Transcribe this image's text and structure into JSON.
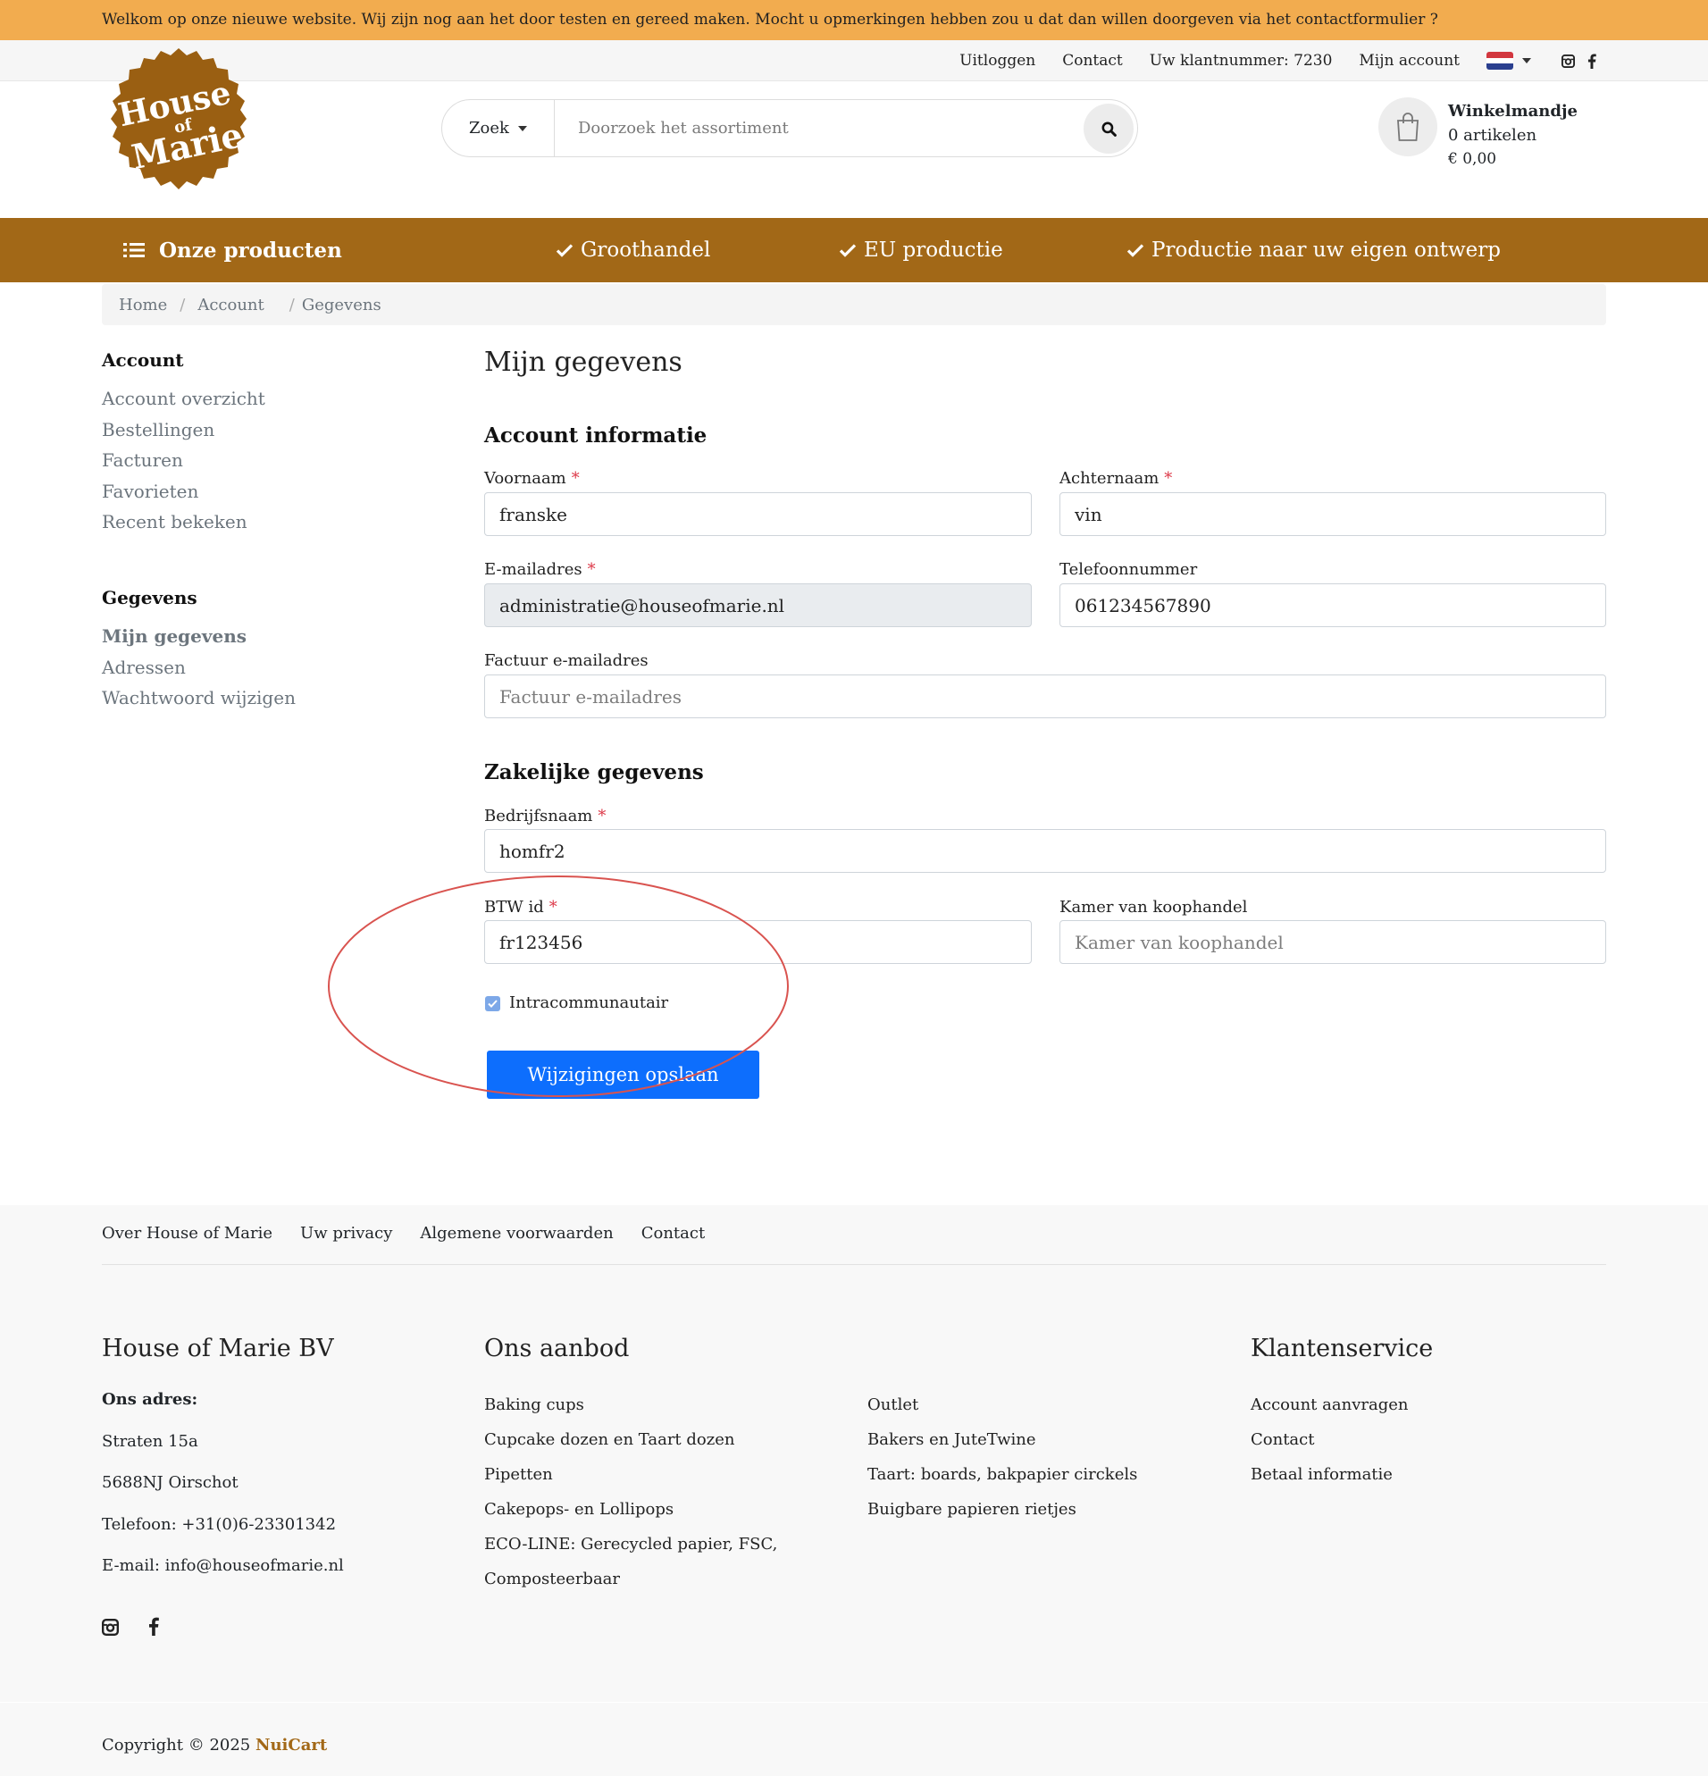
{
  "announcement": "Welkom op onze nieuwe website. Wij zijn nog aan het door testen en gereed maken. Mocht u opmerkingen hebben zou u dat dan willen doorgeven via het contactformulier ?",
  "topbar": {
    "logout": "Uitloggen",
    "contact": "Contact",
    "customer_number": "Uw klantnummer: 7230",
    "my_account": "Mijn account",
    "language_icon": "netherlands-flag-icon"
  },
  "logo": {
    "line1": "House",
    "line2": "of",
    "line3": "Marie"
  },
  "search": {
    "category": "Zoek",
    "placeholder": "Doorzoek het assortiment"
  },
  "cart": {
    "title": "Winkelmandje",
    "items": "0 artikelen",
    "total": "€ 0,00"
  },
  "nav": {
    "products": "Onze producten",
    "wholesale": "Groothandel",
    "eu": "EU productie",
    "custom": "Productie naar uw eigen ontwerp"
  },
  "breadcrumb": {
    "home": "Home",
    "account": "Account",
    "current": "Gegevens"
  },
  "sidebar": {
    "account_title": "Account",
    "account_items": [
      "Account overzicht",
      "Bestellingen",
      "Facturen",
      "Favorieten",
      "Recent bekeken"
    ],
    "data_title": "Gegevens",
    "data_items": [
      "Mijn gegevens",
      "Adressen",
      "Wachtwoord wijzigen"
    ]
  },
  "main": {
    "title": "Mijn gegevens",
    "account_section": "Account informatie",
    "firstname_label": "Voornaam",
    "firstname_value": "franske",
    "lastname_label": "Achternaam",
    "lastname_value": "vin",
    "email_label": "E-mailadres",
    "email_value": "administratie@houseofmarie.nl",
    "phone_label": "Telefoonnummer",
    "phone_value": "061234567890",
    "invoice_email_label": "Factuur e-mailadres",
    "invoice_email_placeholder": "Factuur e-mailadres",
    "business_section": "Zakelijke gegevens",
    "company_label": "Bedrijfsnaam",
    "company_value": "homfr2",
    "vat_label": "BTW id",
    "vat_value": "fr123456",
    "coc_label": "Kamer van koophandel",
    "coc_placeholder": "Kamer van koophandel",
    "intracom_label": "Intracommunautair",
    "intracom_checked": true,
    "required_mark": "*",
    "save_button": "Wijzigingen opslaan"
  },
  "footer": {
    "links": [
      "Over House of Marie",
      "Uw privacy",
      "Algemene voorwaarden",
      "Contact"
    ],
    "company": {
      "title": "House of Marie BV",
      "address_label": "Ons adres:",
      "street": "Straten 15a",
      "city": "5688NJ Oirschot",
      "phone": "Telefoon: +31(0)6-23301342",
      "email": "E-mail: info@houseofmarie.nl"
    },
    "offer": {
      "title": "Ons aanbod",
      "col1": [
        "Baking cups",
        "Cupcake dozen en Taart dozen",
        "Pipetten",
        "Cakepops- en Lollipops",
        "ECO-LINE: Gerecycled papier, FSC,",
        "Composteerbaar"
      ],
      "col2": [
        "Outlet",
        "Bakers en JuteTwine",
        "Taart: boards, bakpapier circkels",
        "Buigbare papieren rietjes"
      ]
    },
    "service": {
      "title": "Klantenservice",
      "items": [
        "Account aanvragen",
        "Contact",
        "Betaal informatie"
      ]
    },
    "copyright": "Copyright © 2025",
    "brand": "NuiCart"
  },
  "colors": {
    "brand_brown": "#a26817",
    "announce_orange": "#f2ac4f",
    "primary_blue": "#0d6efd",
    "annotation_red": "#d9534f"
  }
}
